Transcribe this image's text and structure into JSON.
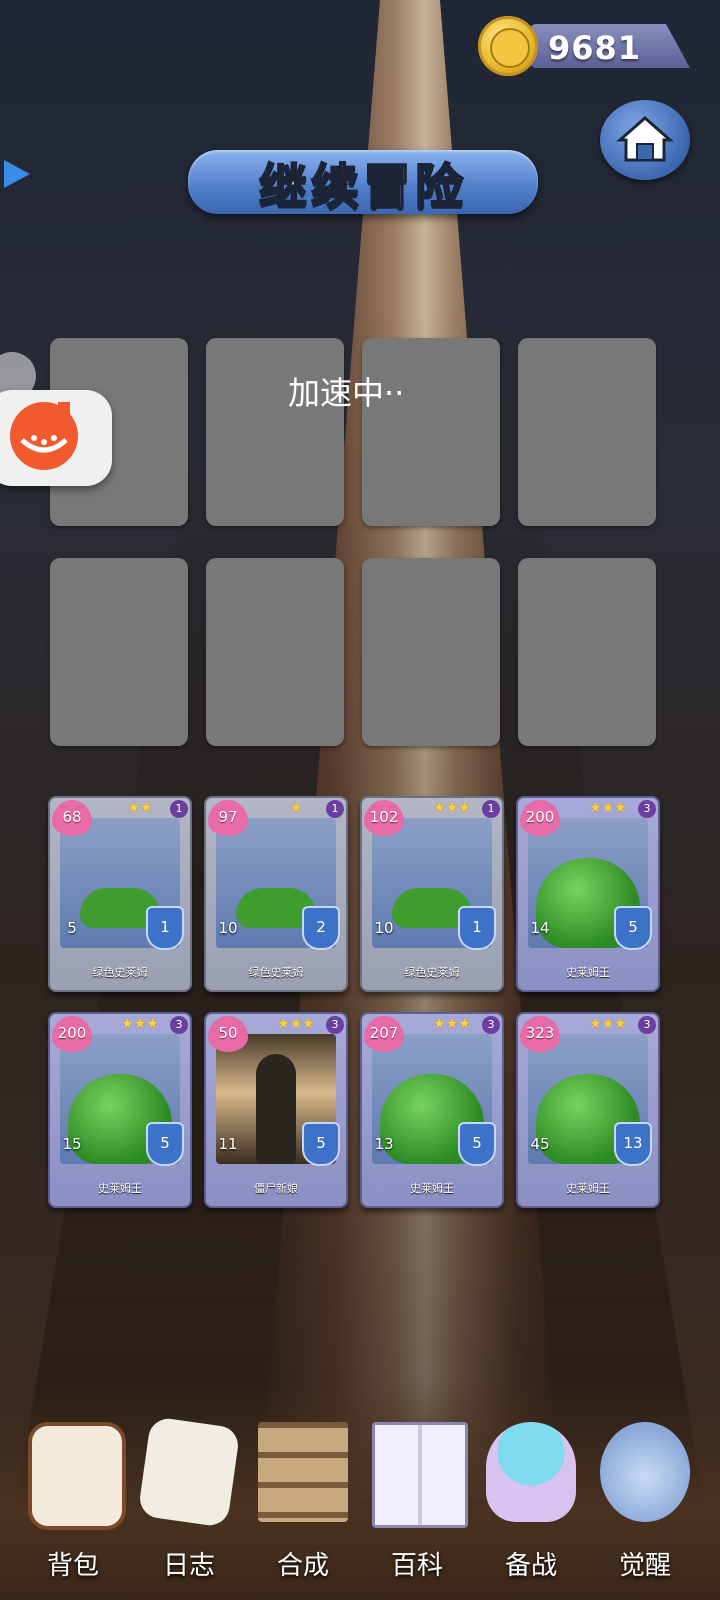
{
  "currency": {
    "coins": "9681",
    "icon": "gold-coin-icon"
  },
  "header": {
    "title": "继续冒险",
    "home_icon": "home-icon",
    "arrow_icon": "play-arrow-icon"
  },
  "board": {
    "status_text": "加速中··"
  },
  "cards": [
    {
      "hp": "68",
      "stars": "★★",
      "tier": "1",
      "atk": "5",
      "def": "1",
      "name": "绿色史莱姆",
      "art": "green-slime"
    },
    {
      "hp": "97",
      "stars": "★",
      "tier": "1",
      "atk": "10",
      "def": "2",
      "name": "绿色史莱姆",
      "art": "green-slime"
    },
    {
      "hp": "102",
      "stars": "★★★",
      "tier": "1",
      "atk": "10",
      "def": "1",
      "name": "绿色史莱姆",
      "art": "green-slime"
    },
    {
      "hp": "200",
      "stars": "★★★",
      "tier": "3",
      "atk": "14",
      "def": "5",
      "name": "史莱姆王",
      "art": "king-slime"
    },
    {
      "hp": "200",
      "stars": "★★★",
      "tier": "3",
      "atk": "15",
      "def": "5",
      "name": "史莱姆王",
      "art": "king-slime"
    },
    {
      "hp": "50",
      "stars": "★★★",
      "tier": "3",
      "atk": "11",
      "def": "5",
      "name": "僵尸新娘",
      "art": "bride"
    },
    {
      "hp": "207",
      "stars": "★★★",
      "tier": "3",
      "atk": "13",
      "def": "5",
      "name": "史莱姆王",
      "art": "king-slime"
    },
    {
      "hp": "323",
      "stars": "★★★",
      "tier": "3",
      "atk": "45",
      "def": "13",
      "name": "史莱姆王",
      "art": "king-slime"
    }
  ],
  "nav": [
    {
      "label": "背包",
      "icon": "backpack-icon"
    },
    {
      "label": "日志",
      "icon": "journal-icon"
    },
    {
      "label": "合成",
      "icon": "crafting-shelf-icon"
    },
    {
      "label": "百科",
      "icon": "encyclopedia-book-icon"
    },
    {
      "label": "备战",
      "icon": "mushroom-spirit-icon"
    },
    {
      "label": "觉醒",
      "icon": "awakening-orb-icon"
    }
  ]
}
